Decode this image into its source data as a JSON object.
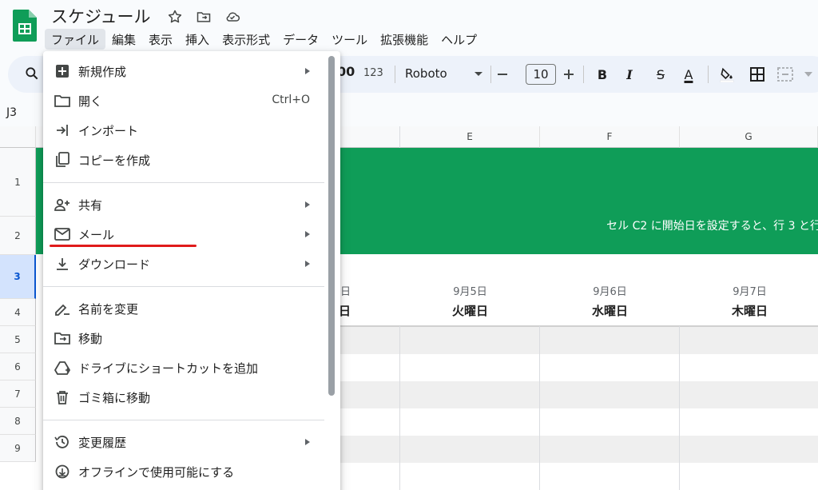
{
  "app": {
    "doc_title": "スケジュール",
    "brand_color": "#0f9d58"
  },
  "menubar": {
    "items": [
      "ファイル",
      "編集",
      "表示",
      "挿入",
      "表示形式",
      "データ",
      "ツール",
      "拡張機能",
      "ヘルプ"
    ],
    "active": "ファイル"
  },
  "toolbar": {
    "format_123": "123",
    "font": "Roboto",
    "font_size": "10",
    "bold": "B",
    "italic": "I",
    "strike": "S",
    "text_color": "A"
  },
  "formula_bar": {
    "name_box": "J3"
  },
  "grid": {
    "columns": [
      "E",
      "F",
      "G"
    ],
    "rows": [
      "1",
      "2",
      "3",
      "4",
      "5",
      "6",
      "7",
      "8",
      "9"
    ],
    "selected_row": "3",
    "banner_text": "セル C2 に開始日を設定すると、行 3 と行",
    "partial_date": "日",
    "partial_weekday": "日",
    "days": [
      {
        "date": "9月5日",
        "weekday": "火曜日"
      },
      {
        "date": "9月6日",
        "weekday": "水曜日"
      },
      {
        "date": "9月7日",
        "weekday": "木曜日"
      }
    ]
  },
  "file_menu": {
    "items": [
      {
        "label": "新規作成",
        "icon": "plus-box-icon",
        "submenu": true
      },
      {
        "label": "開く",
        "icon": "folder-icon",
        "shortcut": "Ctrl+O"
      },
      {
        "label": "インポート",
        "icon": "import-icon"
      },
      {
        "label": "コピーを作成",
        "icon": "copy-icon"
      },
      {
        "label": "共有",
        "icon": "person-add-icon",
        "submenu": true
      },
      {
        "label": "メール",
        "icon": "mail-icon",
        "submenu": true
      },
      {
        "label": "ダウンロード",
        "icon": "download-icon",
        "submenu": true
      },
      {
        "label": "名前を変更",
        "icon": "rename-icon"
      },
      {
        "label": "移動",
        "icon": "move-folder-icon"
      },
      {
        "label": "ドライブにショートカットを追加",
        "icon": "drive-shortcut-icon"
      },
      {
        "label": "ゴミ箱に移動",
        "icon": "trash-icon"
      },
      {
        "label": "変更履歴",
        "icon": "history-icon",
        "submenu": true
      },
      {
        "label": "オフラインで使用可能にする",
        "icon": "offline-icon"
      }
    ]
  }
}
